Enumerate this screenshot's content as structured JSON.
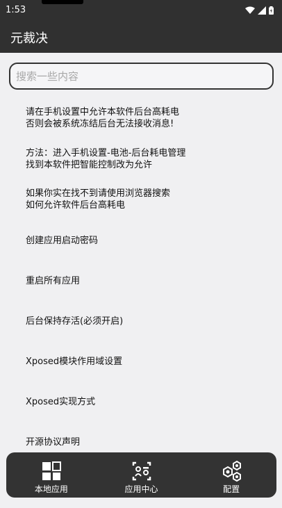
{
  "status_bar": {
    "time": "1:53"
  },
  "app_bar": {
    "title": "元裁决"
  },
  "search": {
    "placeholder": "搜索一些内容",
    "value": ""
  },
  "list": [
    {
      "lines": [
        "请在手机设置中允许本软件后台高耗电",
        "否则会被系统冻结后台无法接收消息!"
      ]
    },
    {
      "lines": [
        "方法：进入手机设置-电池-后台耗电管理",
        "找到本软件把智能控制改为允许"
      ]
    },
    {
      "lines": [
        "如果你实在找不到请使用浏览器搜索",
        "如何允许软件后台高耗电"
      ]
    },
    {
      "lines": [
        "创建应用启动密码"
      ]
    },
    {
      "lines": [
        "重启所有应用"
      ]
    },
    {
      "lines": [
        "后台保持存活(必须开启)"
      ]
    },
    {
      "lines": [
        "Xposed模块作用域设置"
      ]
    },
    {
      "lines": [
        "Xposed实现方式"
      ]
    },
    {
      "lines": [
        "开源协议声明"
      ]
    }
  ],
  "bottom_nav": [
    {
      "label": "本地应用",
      "icon": "grid-icon"
    },
    {
      "label": "应用中心",
      "icon": "app-center-icon"
    },
    {
      "label": "配置",
      "icon": "hexagon-settings-icon"
    }
  ],
  "colors": {
    "bar": "#303030",
    "background": "#f0f0f2",
    "nav": "#333333"
  }
}
